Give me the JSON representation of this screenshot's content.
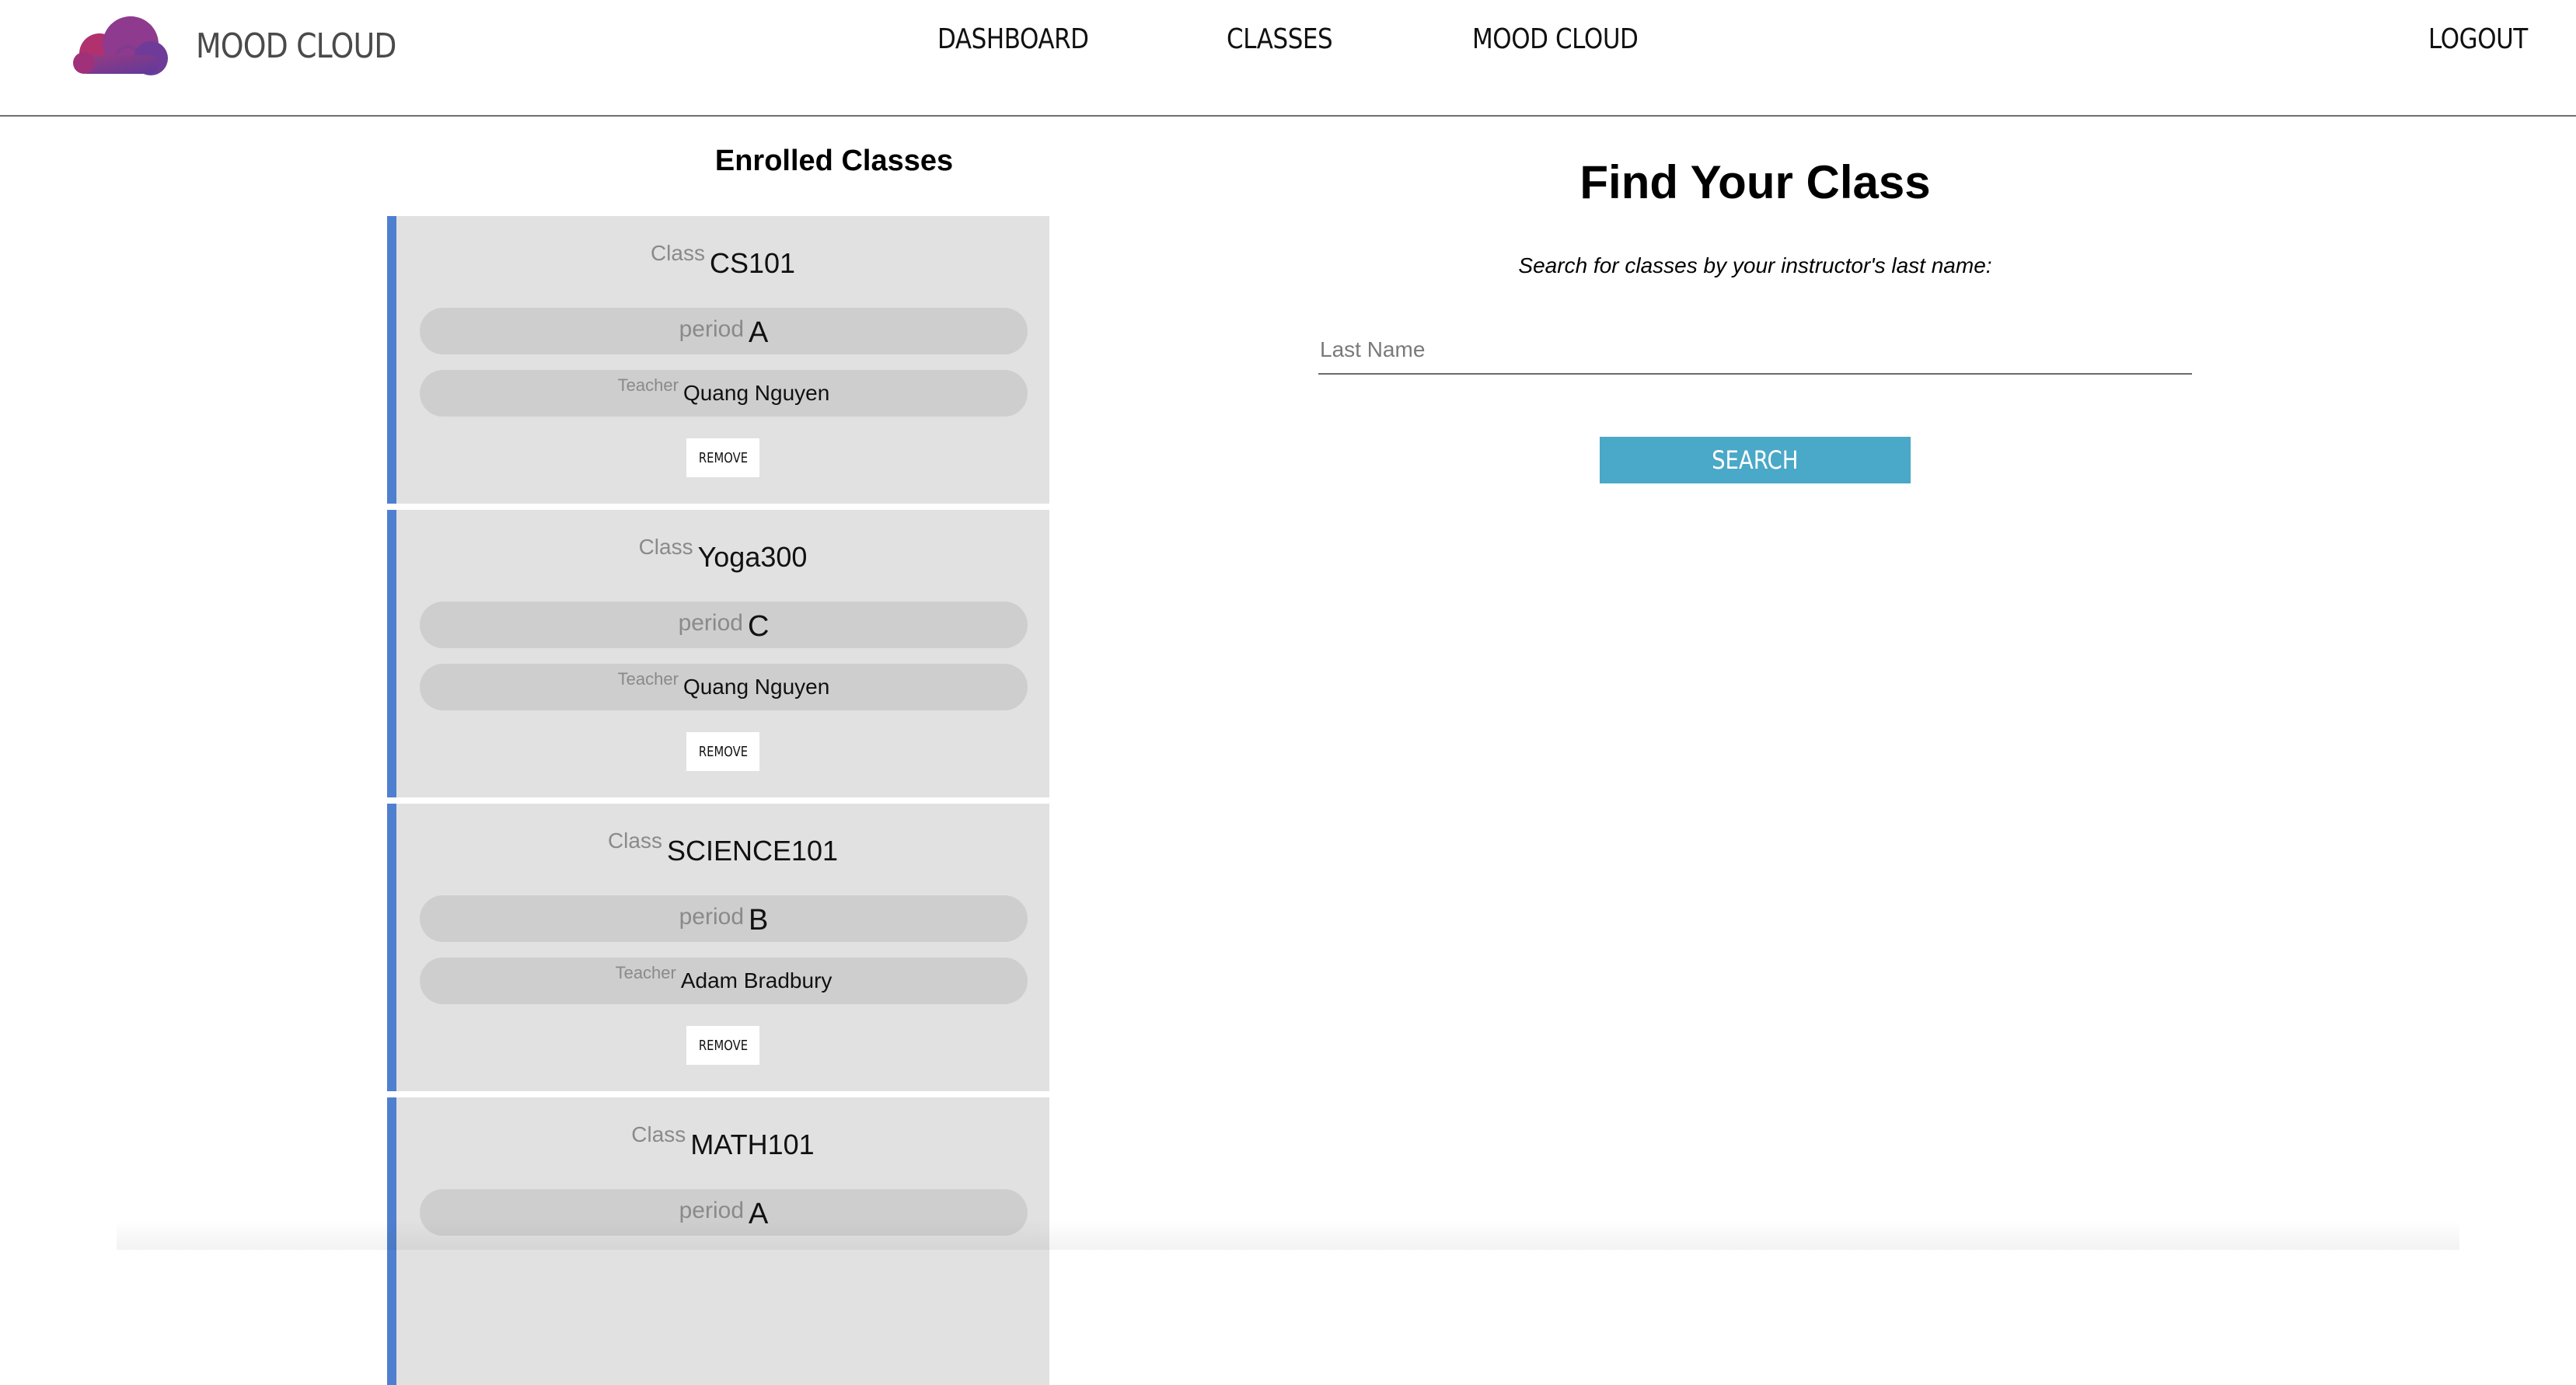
{
  "nav": {
    "brand": "MOOD CLOUD",
    "links": [
      "DASHBOARD",
      "CLASSES",
      "MOOD CLOUD"
    ],
    "logout": "LOGOUT",
    "logo_colors": [
      "#8e3a8e",
      "#b1306e",
      "#6e3b99"
    ]
  },
  "enrolled": {
    "title": "Enrolled Classes",
    "class_label": "Class",
    "period_label": "period",
    "teacher_label": "Teacher",
    "remove_label": "REMOVE",
    "accent_color": "#4f7fcf",
    "classes": [
      {
        "name": "CS101",
        "period": "A",
        "teacher": "Quang Nguyen"
      },
      {
        "name": "Yoga300",
        "period": "C",
        "teacher": "Quang Nguyen"
      },
      {
        "name": "SCIENCE101",
        "period": "B",
        "teacher": "Adam Bradbury"
      },
      {
        "name": "MATH101",
        "period": "A",
        "teacher": ""
      }
    ]
  },
  "find": {
    "title": "Find Your Class",
    "subtitle": "Search for classes by your instructor's last name:",
    "input_placeholder": "Last Name",
    "search_label": "SEARCH",
    "button_color": "#4aa8c8"
  }
}
